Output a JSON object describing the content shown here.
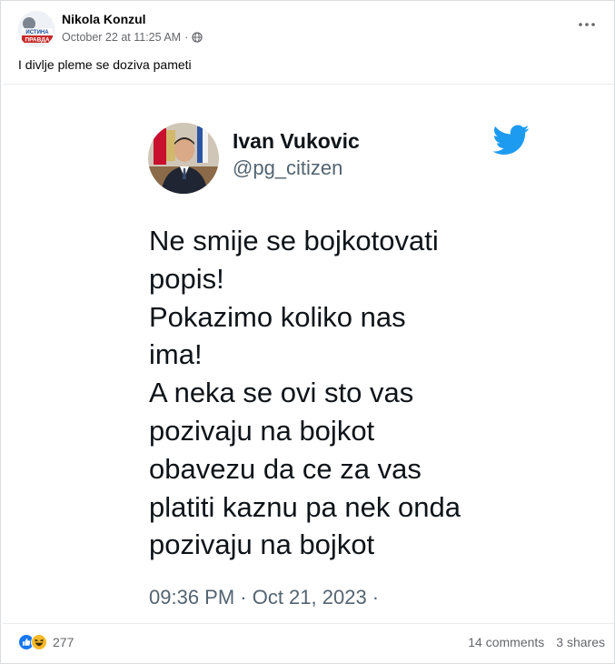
{
  "post": {
    "author": "Nikola Konzul",
    "date": "October 22 at 11:25 AM",
    "separator": "·",
    "privacy_icon": "globe-icon",
    "more_icon": "more-horizontal-icon",
    "caption": "I divlje pleme se doziva pameti",
    "avatar_text_line1": "ИСТИНА",
    "avatar_text_line2": "ПРАВДА"
  },
  "tweet": {
    "name": "Ivan Vukovic",
    "handle": "@pg_citizen",
    "bird_icon": "twitter-bird-icon",
    "lines": [
      "Ne smije se bojkotovati",
      "popis!",
      "Pokazimo koliko nas",
      "ima!",
      "A neka se ovi sto vas",
      "pozivaju na bojkot",
      "obavezu da ce za vas",
      "platiti kaznu pa nek onda",
      "pozivaju na bojkot"
    ],
    "timestamp": "09:36 PM · Oct 21, 2023 ·"
  },
  "footer": {
    "reaction_icons": [
      "like-icon",
      "haha-icon"
    ],
    "reaction_count": "277",
    "comments": "14 comments",
    "shares": "3 shares"
  },
  "colors": {
    "twitter_blue": "#1d9bf0",
    "like_blue": "#1877f2",
    "haha_yellow": "#f7b928",
    "muted_text": "#65676b"
  }
}
